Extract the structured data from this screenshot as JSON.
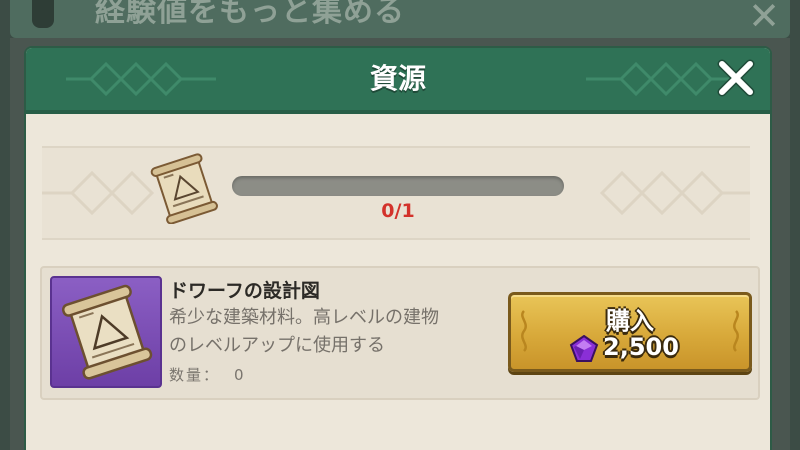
{
  "background": {
    "title": "経験値をもっと集める",
    "close_icon": "close-icon"
  },
  "dialog": {
    "title": "資源",
    "close_icon": "close-icon"
  },
  "progress": {
    "text": "0/1",
    "current": 0,
    "required": 1,
    "icon": "blueprint-scroll-icon"
  },
  "item": {
    "name": "ドワーフの設計図",
    "description_line1": "希少な建築材料。高レベルの建物",
    "description_line2": "のレベルアップに使用する",
    "quantity_label": "数量：",
    "quantity_value": "0",
    "icon": "blueprint-scroll-icon"
  },
  "buy": {
    "label": "購入",
    "price": "2,500",
    "currency_icon": "purple-gem-icon"
  },
  "colors": {
    "header_green": "#2f7256",
    "panel_bg": "#ede7da",
    "progress_text": "#d3322b",
    "button_gold": "#d8a93a",
    "item_thumb_purple": "#7a4ab5"
  }
}
